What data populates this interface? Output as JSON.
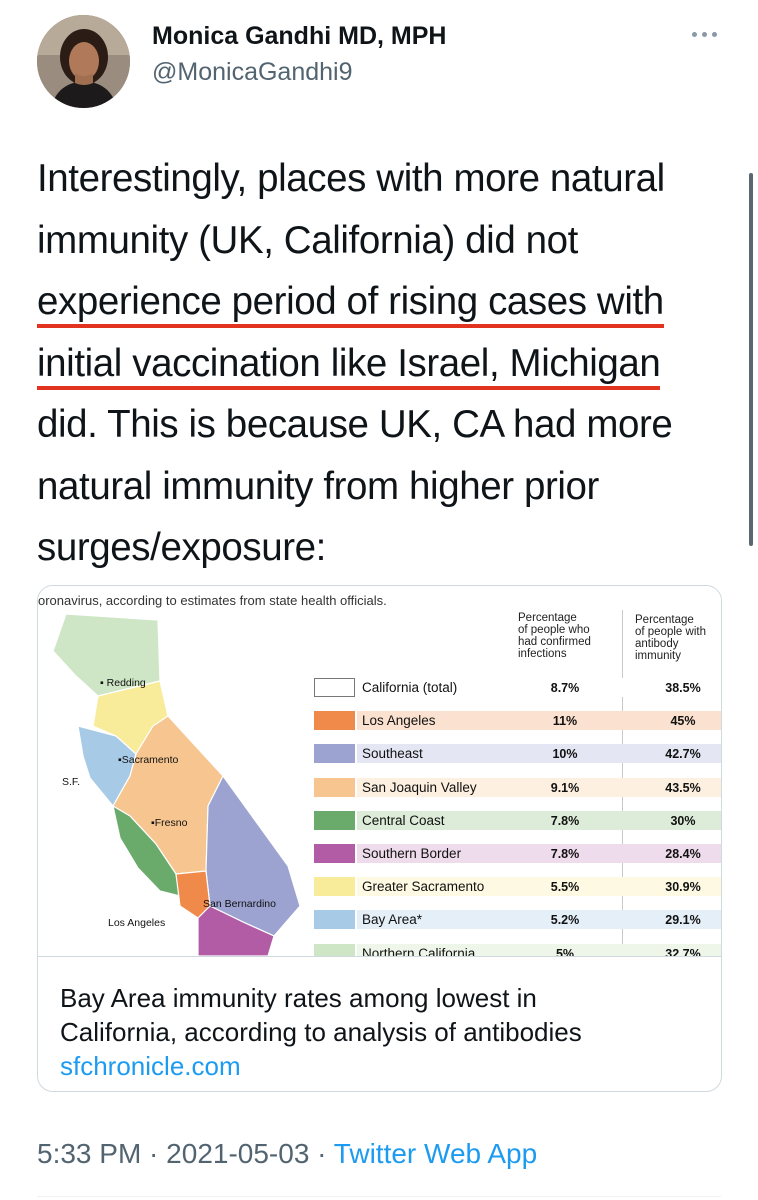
{
  "author": {
    "name": "Monica Gandhi MD, MPH",
    "handle": "@MonicaGandhi9"
  },
  "tweet": {
    "lines": [
      "Interestingly, places with more natural",
      "immunity (UK, California) did not",
      "experience period of rising cases with",
      "initial vaccination like Israel, Michigan",
      "did. This is because UK, CA had more",
      "natural immunity from higher prior",
      "surges/exposure:"
    ],
    "underline_color": "#e1331f"
  },
  "card": {
    "image": {
      "caption": "oronavirus, according to estimates from state health officials.",
      "col_headers": [
        [
          "Percentage",
          "of people who",
          "had confirmed",
          "infections"
        ],
        [
          "Percentage",
          "of people with",
          "antibody",
          "immunity"
        ]
      ],
      "map_labels": {
        "redding": "Redding",
        "sacramento": "Sacramento",
        "sf": "S.F.",
        "fresno": "Fresno",
        "san_bernardino": "San Bernardino",
        "los_angeles": "Los Angeles"
      },
      "rows": [
        {
          "region": "California (total)",
          "confirmed": "8.7%",
          "antibody": "38.5%",
          "swatch": "#ffffff",
          "band": "#ffffff"
        },
        {
          "region": "Los Angeles",
          "confirmed": "11%",
          "antibody": "45%",
          "swatch": "#f08a4b",
          "band": "#fbe1cf"
        },
        {
          "region": "Southeast",
          "confirmed": "10%",
          "antibody": "42.7%",
          "swatch": "#9ca3d0",
          "band": "#e4e6f3"
        },
        {
          "region": "San Joaquin Valley",
          "confirmed": "9.1%",
          "antibody": "43.5%",
          "swatch": "#f6c590",
          "band": "#fdf0e0"
        },
        {
          "region": "Central Coast",
          "confirmed": "7.8%",
          "antibody": "30%",
          "swatch": "#6aab6b",
          "band": "#dcecd9"
        },
        {
          "region": "Southern Border",
          "confirmed": "7.8%",
          "antibody": "28.4%",
          "swatch": "#b35ca6",
          "band": "#eedbeb"
        },
        {
          "region": "Greater Sacramento",
          "confirmed": "5.5%",
          "antibody": "30.9%",
          "swatch": "#f8ec9a",
          "band": "#fdf9e2"
        },
        {
          "region": "Bay Area*",
          "confirmed": "5.2%",
          "antibody": "29.1%",
          "swatch": "#a7cbe6",
          "band": "#e5eff8"
        },
        {
          "region": "Northern California",
          "confirmed": "5%",
          "antibody": "32.7%",
          "swatch": "#cfe6c6",
          "band": "#eef6ea"
        }
      ]
    },
    "title_lines": [
      "Bay Area immunity rates among lowest in",
      "California, according to analysis of antibodies"
    ],
    "domain": "sfchronicle.com"
  },
  "meta": {
    "time": "5:33 PM",
    "sep1": " · ",
    "date": "2021-05-03",
    "sep2": " · ",
    "app": "Twitter Web App"
  }
}
